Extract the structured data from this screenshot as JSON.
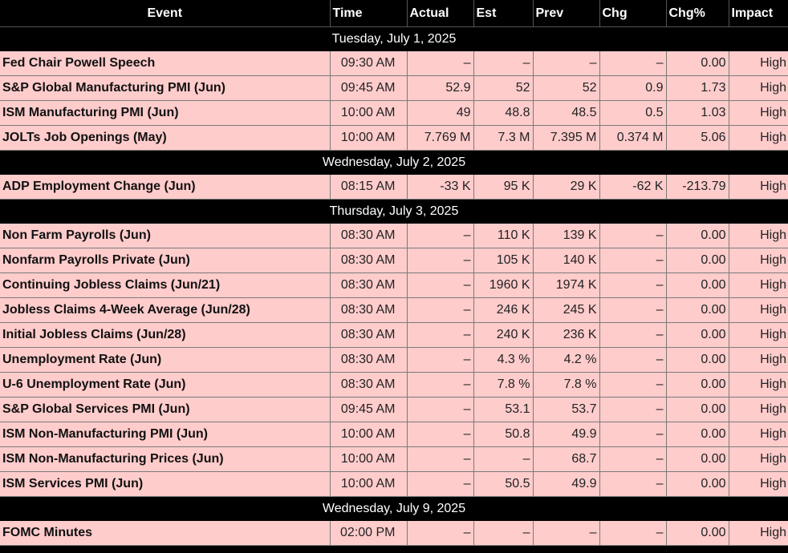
{
  "columns": [
    "Event",
    "Time",
    "Actual",
    "Est",
    "Prev",
    "Chg",
    "Chg%",
    "Impact"
  ],
  "groups": [
    {
      "date": "Tuesday, July 1, 2025",
      "rows": [
        [
          "Fed Chair Powell Speech",
          "09:30 AM",
          "–",
          "–",
          "–",
          "–",
          "0.00",
          "High"
        ],
        [
          "S&P Global Manufacturing PMI (Jun)",
          "09:45 AM",
          "52.9",
          "52",
          "52",
          "0.9",
          "1.73",
          "High"
        ],
        [
          "ISM Manufacturing PMI (Jun)",
          "10:00 AM",
          "49",
          "48.8",
          "48.5",
          "0.5",
          "1.03",
          "High"
        ],
        [
          "JOLTs Job Openings (May)",
          "10:00 AM",
          "7.769 M",
          "7.3 M",
          "7.395 M",
          "0.374 M",
          "5.06",
          "High"
        ]
      ]
    },
    {
      "date": "Wednesday, July 2, 2025",
      "rows": [
        [
          "ADP Employment Change (Jun)",
          "08:15 AM",
          "-33 K",
          "95 K",
          "29 K",
          "-62 K",
          "-213.79",
          "High"
        ]
      ]
    },
    {
      "date": "Thursday, July 3, 2025",
      "rows": [
        [
          "Non Farm Payrolls (Jun)",
          "08:30 AM",
          "–",
          "110 K",
          "139 K",
          "–",
          "0.00",
          "High"
        ],
        [
          "Nonfarm Payrolls Private (Jun)",
          "08:30 AM",
          "–",
          "105 K",
          "140 K",
          "–",
          "0.00",
          "High"
        ],
        [
          "Continuing Jobless Claims (Jun/21)",
          "08:30 AM",
          "–",
          "1960 K",
          "1974 K",
          "–",
          "0.00",
          "High"
        ],
        [
          "Jobless Claims 4-Week Average (Jun/28)",
          "08:30 AM",
          "–",
          "246 K",
          "245 K",
          "–",
          "0.00",
          "High"
        ],
        [
          "Initial Jobless Claims (Jun/28)",
          "08:30 AM",
          "–",
          "240 K",
          "236 K",
          "–",
          "0.00",
          "High"
        ],
        [
          "Unemployment Rate (Jun)",
          "08:30 AM",
          "–",
          "4.3 %",
          "4.2 %",
          "–",
          "0.00",
          "High"
        ],
        [
          "U-6 Unemployment Rate (Jun)",
          "08:30 AM",
          "–",
          "7.8 %",
          "7.8 %",
          "–",
          "0.00",
          "High"
        ],
        [
          "S&P Global Services PMI (Jun)",
          "09:45 AM",
          "–",
          "53.1",
          "53.7",
          "–",
          "0.00",
          "High"
        ],
        [
          "ISM Non-Manufacturing PMI (Jun)",
          "10:00 AM",
          "–",
          "50.8",
          "49.9",
          "–",
          "0.00",
          "High"
        ],
        [
          "ISM Non-Manufacturing Prices (Jun)",
          "10:00 AM",
          "–",
          "–",
          "68.7",
          "–",
          "0.00",
          "High"
        ],
        [
          "ISM Services PMI (Jun)",
          "10:00 AM",
          "–",
          "50.5",
          "49.9",
          "–",
          "0.00",
          "High"
        ]
      ]
    },
    {
      "date": "Wednesday, July 9, 2025",
      "rows": [
        [
          "FOMC Minutes",
          "02:00 PM",
          "–",
          "–",
          "–",
          "–",
          "0.00",
          "High"
        ]
      ]
    }
  ]
}
